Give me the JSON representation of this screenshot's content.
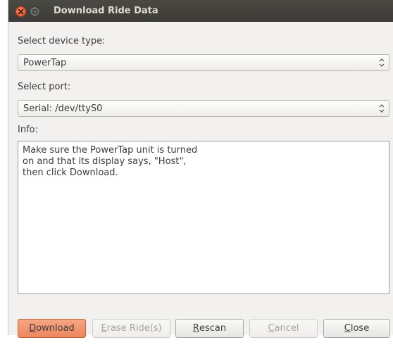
{
  "window": {
    "title": "Download Ride Data"
  },
  "device": {
    "label": "Select device type:",
    "selected": "PowerTap"
  },
  "port": {
    "label": "Select port:",
    "selected": "Serial: /dev/ttyS0"
  },
  "info": {
    "label": "Info:",
    "text": "Make sure the PowerTap unit is turned\non and that its display says, \"Host\",\nthen click Download."
  },
  "buttons": {
    "download": {
      "mnemonic": "D",
      "rest": "ownload"
    },
    "erase": {
      "mnemonic": "E",
      "rest": "rase Ride(s)"
    },
    "rescan": {
      "mnemonic": "R",
      "rest": "escan"
    },
    "cancel": {
      "mnemonic": "C",
      "rest": "ancel"
    },
    "close": {
      "mnemonic": "C",
      "rest": "lose"
    }
  },
  "colors": {
    "accent": "#ec8660",
    "titlebar": "#3c3b37",
    "close_button": "#e1491c"
  }
}
